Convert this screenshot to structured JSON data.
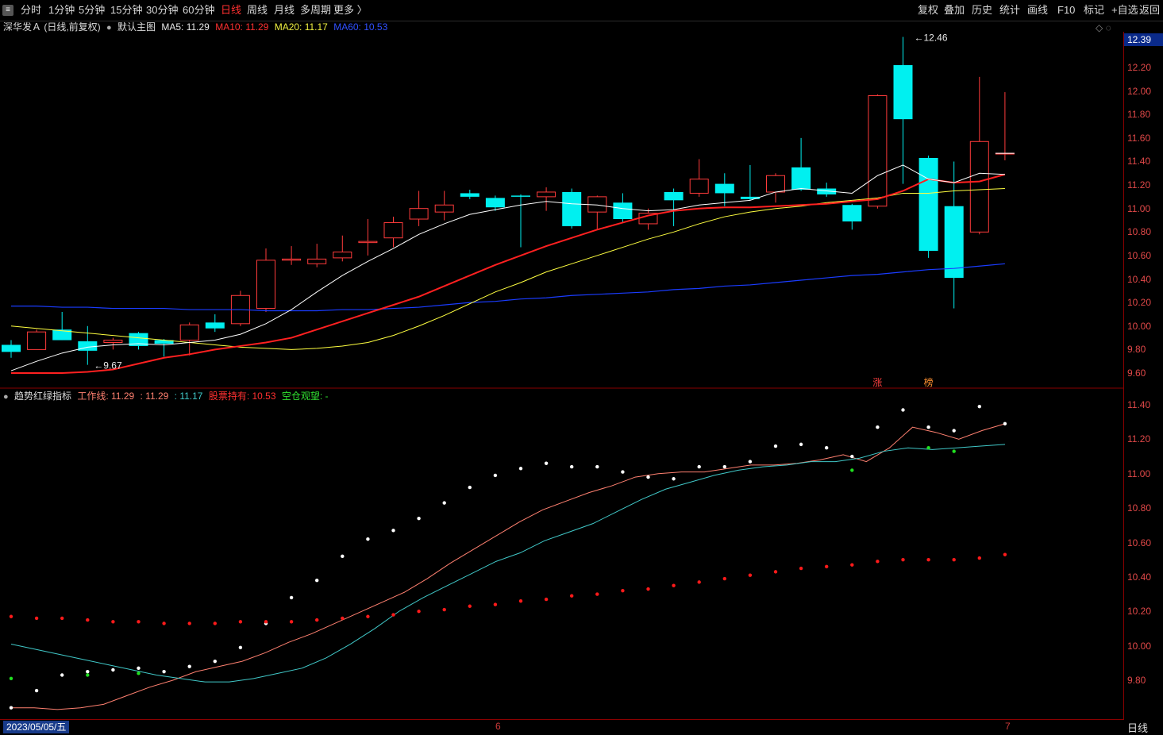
{
  "toolbar": {
    "left": [
      "分时",
      "1分钟",
      "5分钟",
      "15分钟",
      "30分钟",
      "60分钟",
      "日线",
      "周线",
      "月线",
      "多周期",
      "更多 〉"
    ],
    "active": "日线",
    "right": [
      "复权",
      "叠加",
      "历史",
      "统计",
      "画线",
      "F10",
      "标记",
      "+自选",
      "返回"
    ]
  },
  "main_panel": {
    "stock": "深华发Ａ (日线,前复权)",
    "template": "默认主图",
    "ma5": "MA5: 11.29",
    "ma10": "MA10: 11.29",
    "ma20": "MA20: 11.17",
    "ma60": "MA60: 10.53",
    "high_label": "12.46",
    "low_label": "9.67",
    "current_price": "12.39",
    "tag_zhang": "涨",
    "tag_bang": "榜"
  },
  "sub_panel": {
    "name": "趋势红绿指标",
    "work": "工作线: 11.29",
    "v2": ": 11.29",
    "v3": ": 11.17",
    "hold": "股票持有: 10.53",
    "wait": "空仓观望: -"
  },
  "bottom": {
    "date": "2023/05/05/五",
    "month6": "6",
    "month7": "7",
    "period": "日线"
  },
  "colors": {
    "up": "#ff3b3b",
    "down": "#00f0f0",
    "ma5": "#ffffff",
    "ma10": "#ff2020",
    "ma20": "#ffff40",
    "ma60": "#1a3cff"
  },
  "chart_data": [
    {
      "type": "candlestick",
      "title": "深华发Ａ (日线,前复权)",
      "ylim": [
        9.5,
        12.5
      ],
      "y_ticks": [
        9.6,
        9.8,
        10.0,
        10.2,
        10.4,
        10.6,
        10.8,
        11.0,
        11.2,
        11.4,
        11.6,
        11.8,
        12.0,
        12.2
      ],
      "candles": [
        {
          "o": 9.84,
          "h": 9.88,
          "l": 9.73,
          "c": 9.78
        },
        {
          "o": 9.8,
          "h": 9.97,
          "l": 9.8,
          "c": 9.95
        },
        {
          "o": 9.97,
          "h": 10.12,
          "l": 9.88,
          "c": 9.88
        },
        {
          "o": 9.87,
          "h": 10.0,
          "l": 9.67,
          "c": 9.79
        },
        {
          "o": 9.86,
          "h": 9.9,
          "l": 9.8,
          "c": 9.88
        },
        {
          "o": 9.94,
          "h": 9.95,
          "l": 9.8,
          "c": 9.83
        },
        {
          "o": 9.88,
          "h": 9.89,
          "l": 9.74,
          "c": 9.85
        },
        {
          "o": 9.88,
          "h": 10.03,
          "l": 9.75,
          "c": 10.01
        },
        {
          "o": 10.03,
          "h": 10.1,
          "l": 9.95,
          "c": 9.98
        },
        {
          "o": 10.02,
          "h": 10.3,
          "l": 10.0,
          "c": 10.26
        },
        {
          "o": 10.15,
          "h": 10.66,
          "l": 10.12,
          "c": 10.56
        },
        {
          "o": 10.56,
          "h": 10.68,
          "l": 10.52,
          "c": 10.57
        },
        {
          "o": 10.53,
          "h": 10.7,
          "l": 10.5,
          "c": 10.57
        },
        {
          "o": 10.58,
          "h": 10.77,
          "l": 10.55,
          "c": 10.63
        },
        {
          "o": 10.71,
          "h": 10.91,
          "l": 10.6,
          "c": 10.72
        },
        {
          "o": 10.75,
          "h": 10.93,
          "l": 10.67,
          "c": 10.88
        },
        {
          "o": 10.91,
          "h": 11.15,
          "l": 10.85,
          "c": 11.0
        },
        {
          "o": 10.97,
          "h": 11.15,
          "l": 10.9,
          "c": 11.03
        },
        {
          "o": 11.13,
          "h": 11.16,
          "l": 11.08,
          "c": 11.1
        },
        {
          "o": 11.09,
          "h": 11.11,
          "l": 10.98,
          "c": 11.01
        },
        {
          "o": 11.11,
          "h": 11.12,
          "l": 10.67,
          "c": 11.1
        },
        {
          "o": 11.1,
          "h": 11.18,
          "l": 10.98,
          "c": 11.14
        },
        {
          "o": 11.14,
          "h": 11.17,
          "l": 10.83,
          "c": 10.85
        },
        {
          "o": 10.97,
          "h": 11.11,
          "l": 10.82,
          "c": 11.1
        },
        {
          "o": 11.05,
          "h": 11.13,
          "l": 10.88,
          "c": 10.91
        },
        {
          "o": 10.87,
          "h": 11.0,
          "l": 10.82,
          "c": 10.96
        },
        {
          "o": 11.14,
          "h": 11.17,
          "l": 10.85,
          "c": 11.07
        },
        {
          "o": 11.13,
          "h": 11.42,
          "l": 11.1,
          "c": 11.25
        },
        {
          "o": 11.21,
          "h": 11.3,
          "l": 11.02,
          "c": 11.13
        },
        {
          "o": 11.1,
          "h": 11.37,
          "l": 11.07,
          "c": 11.08
        },
        {
          "o": 11.14,
          "h": 11.3,
          "l": 11.05,
          "c": 11.28
        },
        {
          "o": 11.35,
          "h": 11.6,
          "l": 11.15,
          "c": 11.16
        },
        {
          "o": 11.17,
          "h": 11.22,
          "l": 11.1,
          "c": 11.12
        },
        {
          "o": 11.03,
          "h": 11.04,
          "l": 10.82,
          "c": 10.89
        },
        {
          "o": 11.02,
          "h": 11.97,
          "l": 11.0,
          "c": 11.96
        },
        {
          "o": 12.22,
          "h": 12.46,
          "l": 11.21,
          "c": 11.76
        },
        {
          "o": 11.43,
          "h": 11.45,
          "l": 10.58,
          "c": 10.64
        },
        {
          "o": 11.02,
          "h": 11.4,
          "l": 10.15,
          "c": 10.41
        },
        {
          "o": 10.8,
          "h": 12.12,
          "l": 10.78,
          "c": 11.57
        },
        {
          "o": 11.47,
          "h": 11.99,
          "l": 11.41,
          "c": 11.47
        }
      ],
      "ma5": [
        9.62,
        9.7,
        9.77,
        9.82,
        9.84,
        9.85,
        9.84,
        9.86,
        9.88,
        9.93,
        10.02,
        10.14,
        10.29,
        10.43,
        10.55,
        10.66,
        10.78,
        10.87,
        10.95,
        10.99,
        11.03,
        11.06,
        11.04,
        11.03,
        11.0,
        10.98,
        10.99,
        11.03,
        11.05,
        11.07,
        11.14,
        11.17,
        11.15,
        11.13,
        11.28,
        11.37,
        11.25,
        11.22,
        11.3,
        11.29
      ],
      "ma10": [
        9.6,
        9.6,
        9.6,
        9.61,
        9.63,
        9.68,
        9.73,
        9.76,
        9.8,
        9.83,
        9.86,
        9.9,
        9.97,
        10.04,
        10.11,
        10.18,
        10.25,
        10.34,
        10.43,
        10.52,
        10.6,
        10.68,
        10.75,
        10.82,
        10.88,
        10.94,
        10.98,
        11.0,
        11.01,
        11.01,
        11.02,
        11.03,
        11.04,
        11.06,
        11.08,
        11.15,
        11.25,
        11.22,
        11.23,
        11.29
      ],
      "ma20": [
        10.0,
        9.98,
        9.96,
        9.94,
        9.92,
        9.9,
        9.88,
        9.86,
        9.84,
        9.82,
        9.81,
        9.8,
        9.81,
        9.83,
        9.86,
        9.92,
        10.0,
        10.09,
        10.19,
        10.29,
        10.37,
        10.46,
        10.53,
        10.6,
        10.67,
        10.74,
        10.8,
        10.87,
        10.93,
        10.97,
        11.0,
        11.02,
        11.05,
        11.07,
        11.09,
        11.13,
        11.13,
        11.15,
        11.16,
        11.17
      ],
      "ma60": [
        10.17,
        10.17,
        10.16,
        10.16,
        10.15,
        10.15,
        10.15,
        10.14,
        10.14,
        10.14,
        10.13,
        10.13,
        10.13,
        10.14,
        10.14,
        10.15,
        10.16,
        10.18,
        10.2,
        10.21,
        10.23,
        10.24,
        10.26,
        10.27,
        10.28,
        10.29,
        10.31,
        10.32,
        10.34,
        10.35,
        10.37,
        10.39,
        10.41,
        10.43,
        10.44,
        10.46,
        10.48,
        10.49,
        10.51,
        10.53
      ]
    },
    {
      "type": "line",
      "title": "趋势红绿指标",
      "ylim": [
        9.68,
        11.46
      ],
      "y_ticks": [
        9.8,
        10.0,
        10.2,
        10.4,
        10.6,
        10.8,
        11.0,
        11.2,
        11.4
      ],
      "series": [
        {
          "name": "工作线",
          "color": "#ff8070",
          "values": [
            9.64,
            9.64,
            9.63,
            9.64,
            9.66,
            9.71,
            9.76,
            9.8,
            9.85,
            9.88,
            9.91,
            9.96,
            10.02,
            10.07,
            10.13,
            10.19,
            10.25,
            10.31,
            10.39,
            10.48,
            10.56,
            10.64,
            10.72,
            10.79,
            10.84,
            10.89,
            10.93,
            10.98,
            11.0,
            11.01,
            11.01,
            11.03,
            11.05,
            11.05,
            11.06,
            11.08,
            11.11,
            11.07,
            11.15,
            11.27,
            11.24,
            11.2,
            11.25,
            11.29
          ]
        },
        {
          "color": "#40c8c8",
          "values": [
            10.01,
            9.98,
            9.95,
            9.92,
            9.89,
            9.86,
            9.83,
            9.81,
            9.79,
            9.79,
            9.81,
            9.84,
            9.87,
            9.93,
            10.01,
            10.1,
            10.2,
            10.28,
            10.35,
            10.42,
            10.49,
            10.54,
            10.61,
            10.66,
            10.71,
            10.78,
            10.85,
            10.91,
            10.95,
            10.99,
            11.02,
            11.04,
            11.05,
            11.07,
            11.07,
            11.09,
            11.13,
            11.15,
            11.14,
            11.15,
            11.16,
            11.17
          ]
        }
      ],
      "dots_white": [
        9.64,
        9.74,
        9.83,
        9.85,
        9.86,
        9.87,
        9.85,
        9.88,
        9.91,
        9.99,
        10.13,
        10.28,
        10.38,
        10.52,
        10.62,
        10.67,
        10.74,
        10.83,
        10.92,
        10.99,
        11.03,
        11.06,
        11.04,
        11.04,
        11.01,
        10.98,
        10.97,
        11.04,
        11.04,
        11.07,
        11.16,
        11.17,
        11.15,
        11.1,
        11.27,
        11.37,
        11.27,
        11.25,
        11.39,
        11.29
      ],
      "dots_red": [
        10.17,
        10.16,
        10.16,
        10.15,
        10.14,
        10.14,
        10.13,
        10.13,
        10.13,
        10.14,
        10.14,
        10.14,
        10.15,
        10.16,
        10.17,
        10.18,
        10.2,
        10.21,
        10.23,
        10.24,
        10.26,
        10.27,
        10.29,
        10.3,
        10.32,
        10.33,
        10.35,
        10.37,
        10.39,
        10.41,
        10.43,
        10.45,
        10.46,
        10.47,
        10.49,
        10.5,
        10.5,
        10.5,
        10.51,
        10.53
      ],
      "dots_green": [
        [
          0,
          9.81
        ],
        [
          3,
          9.83
        ],
        [
          5,
          9.84
        ],
        [
          33,
          11.02
        ],
        [
          36,
          11.15
        ],
        [
          37,
          11.13
        ]
      ]
    }
  ]
}
